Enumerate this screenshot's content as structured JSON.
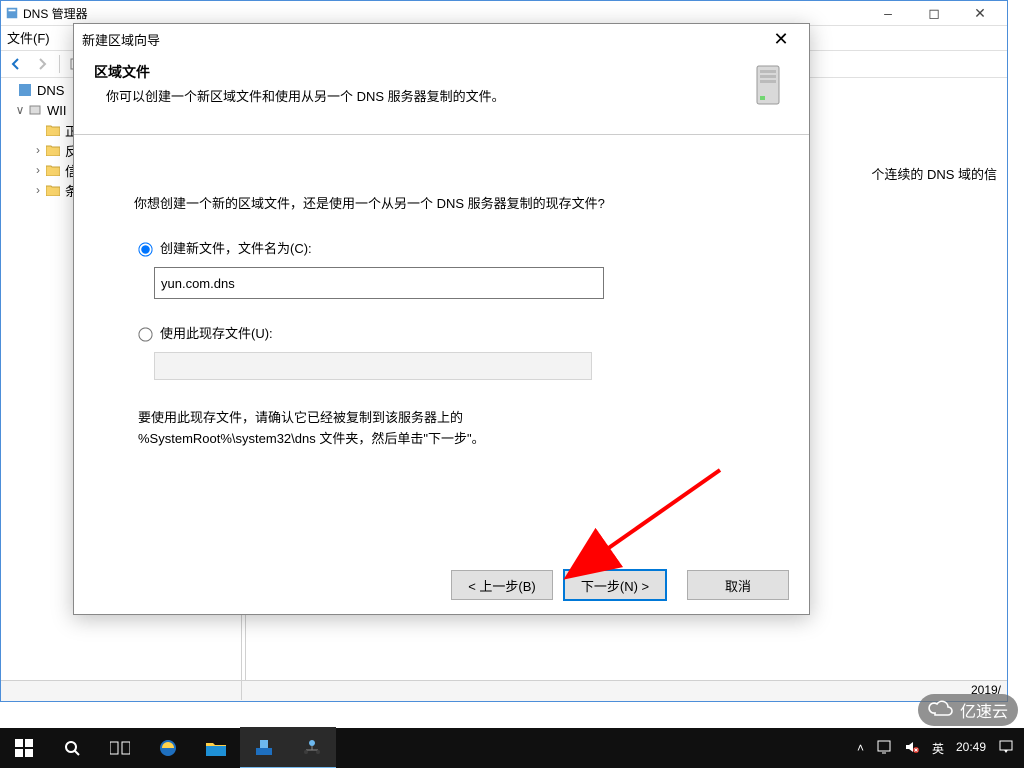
{
  "main_window": {
    "title": "DNS 管理器",
    "menu_file": "文件(F)",
    "tree": {
      "root": "DNS",
      "server": "WII",
      "items": [
        "正",
        "反",
        "信",
        "条"
      ]
    },
    "content_hint": "个连续的 DNS 域的信",
    "status_date": "2019/"
  },
  "wizard": {
    "title": "新建区域向导",
    "header_title": "区域文件",
    "header_sub": "你可以创建一个新区域文件和使用从另一个 DNS 服务器复制的文件。",
    "prompt": "你想创建一个新的区域文件，还是使用一个从另一个 DNS 服务器复制的现存文件?",
    "option_create_label": "创建新文件，文件名为(C):",
    "option_use_label": "使用此现存文件(U):",
    "filename_value": "yun.com.dns",
    "note_line1": "要使用此现存文件，请确认它已经被复制到该服务器上的",
    "note_line2": "%SystemRoot%\\system32\\dns 文件夹，然后单击\"下一步\"。",
    "btn_back": "< 上一步(B)",
    "btn_next": "下一步(N) >",
    "btn_cancel": "取消"
  },
  "taskbar": {
    "ime": "英",
    "time": "20:49"
  },
  "watermark": {
    "text": "亿速云"
  },
  "colors": {
    "accent": "#0078d7",
    "arrow": "#ff0000"
  }
}
